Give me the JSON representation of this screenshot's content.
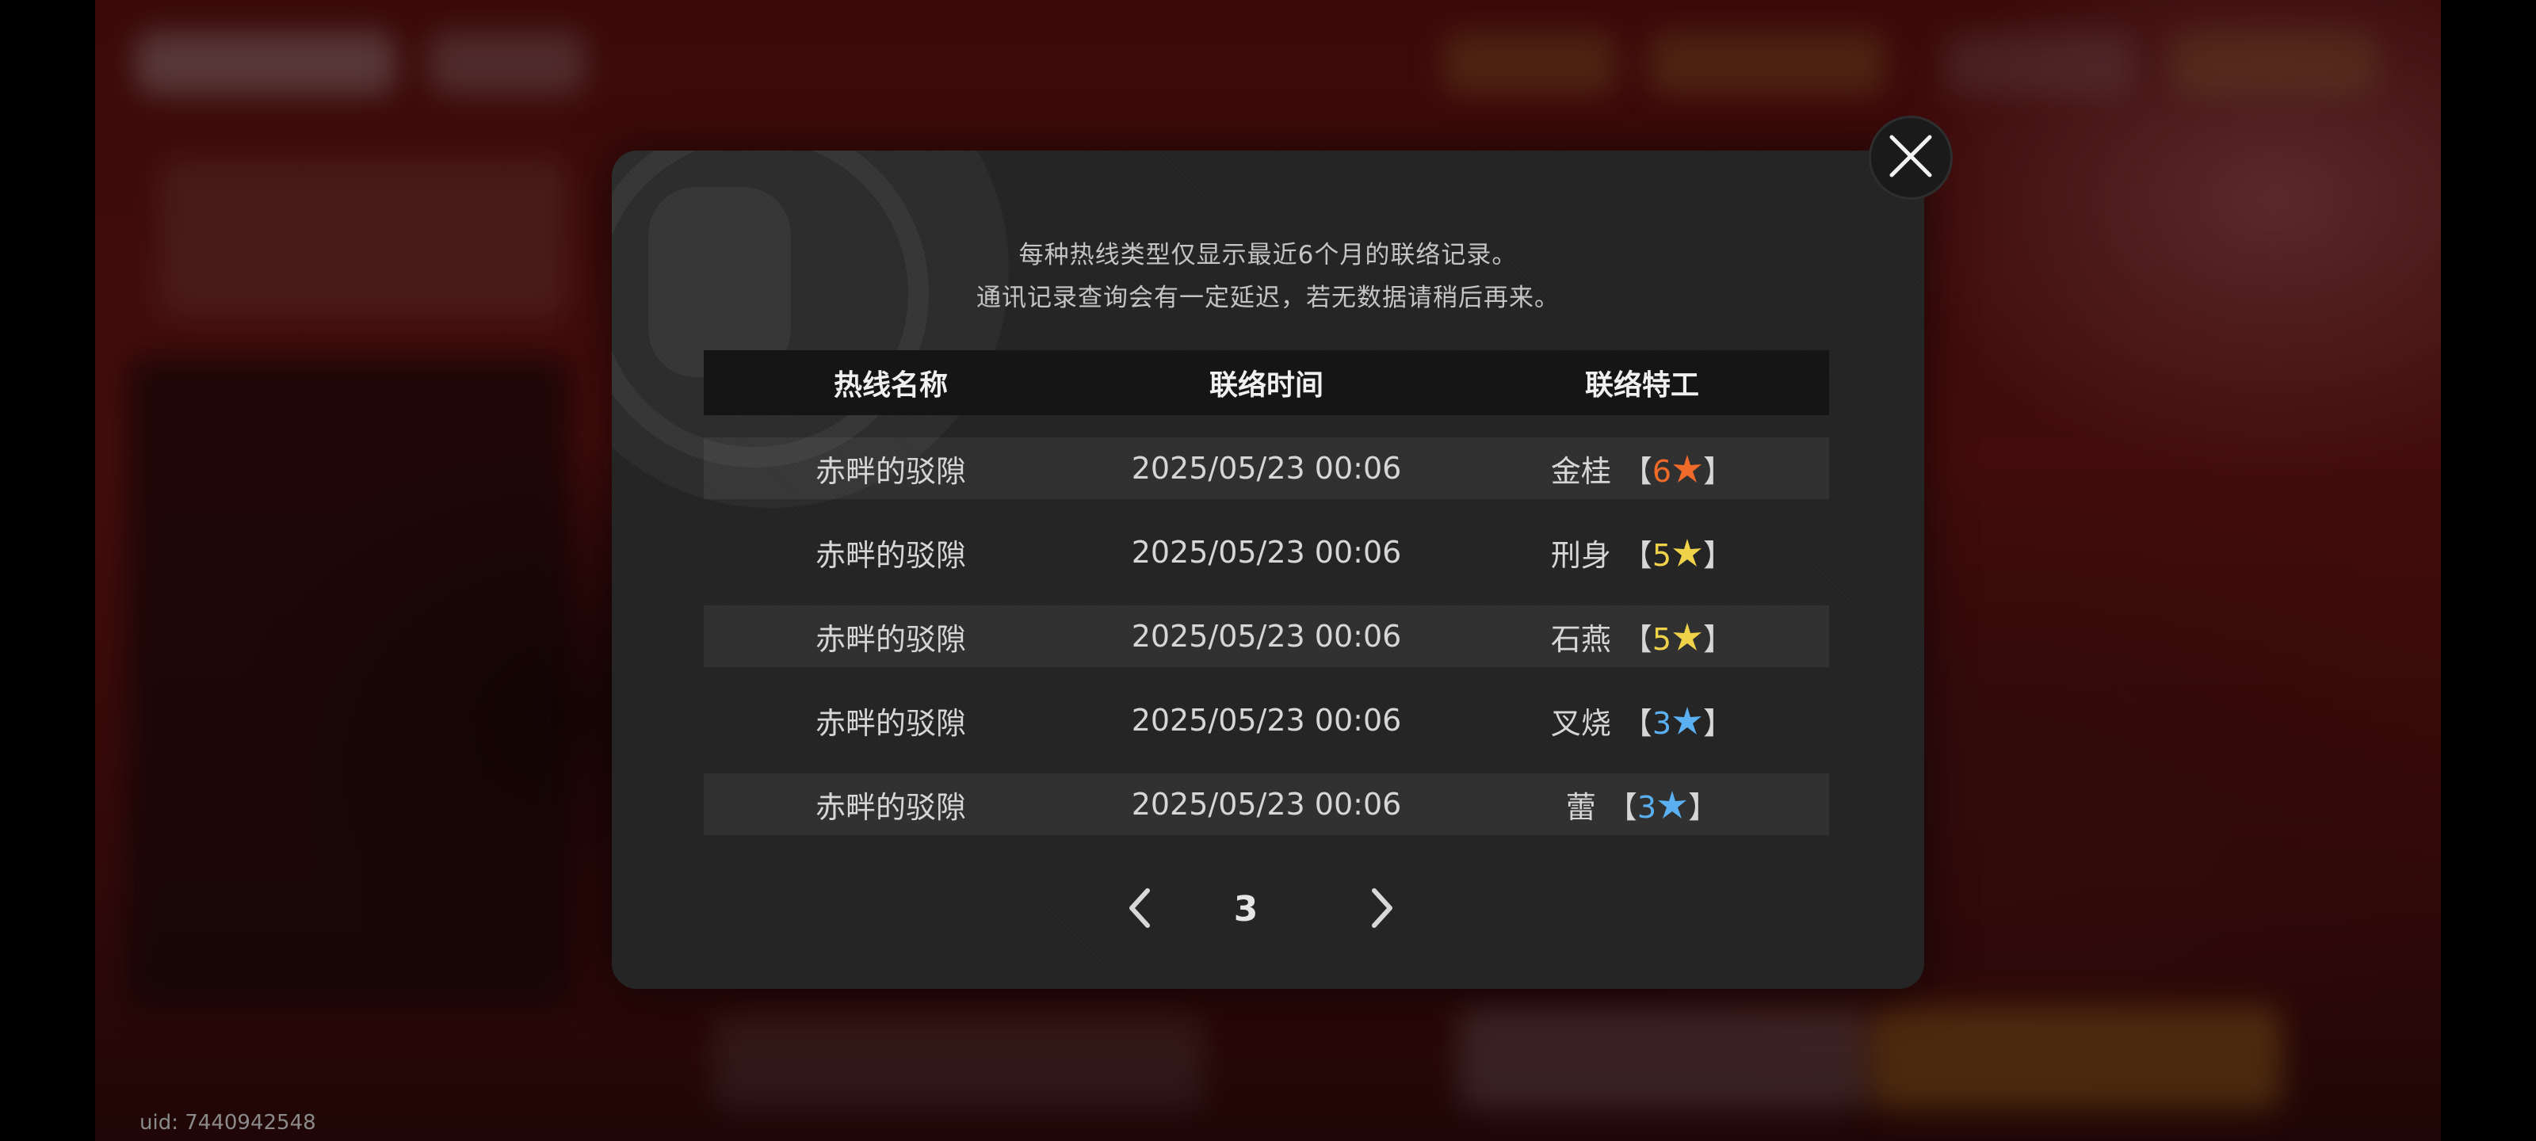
{
  "background": {
    "uid_text": "uid: 7440942548"
  },
  "dialog": {
    "notice_line1": "每种热线类型仅显示最近6个月的联络记录。",
    "notice_line2": "通讯记录查询会有一定延迟，若无数据请稍后再来。",
    "close_icon": "close-icon",
    "columns": [
      "热线名称",
      "联络时间",
      "联络特工"
    ],
    "rows": [
      {
        "hotline": "赤畔的驳隙",
        "time": "2025/05/23 00:06",
        "agent": "金桂",
        "rank": "6",
        "rank_color": "#f06a2a"
      },
      {
        "hotline": "赤畔的驳隙",
        "time": "2025/05/23 00:06",
        "agent": "刑身",
        "rank": "5",
        "rank_color": "#f0d24a"
      },
      {
        "hotline": "赤畔的驳隙",
        "time": "2025/05/23 00:06",
        "agent": "石燕",
        "rank": "5",
        "rank_color": "#f0d24a"
      },
      {
        "hotline": "赤畔的驳隙",
        "time": "2025/05/23 00:06",
        "agent": "叉烧",
        "rank": "3",
        "rank_color": "#5ab0f0"
      },
      {
        "hotline": "赤畔的驳隙",
        "time": "2025/05/23 00:06",
        "agent": "蕾",
        "rank": "3",
        "rank_color": "#5ab0f0"
      }
    ],
    "pagination": {
      "current_page": "3",
      "prev_icon": "chevron-left-icon",
      "next_icon": "chevron-right-icon"
    }
  }
}
